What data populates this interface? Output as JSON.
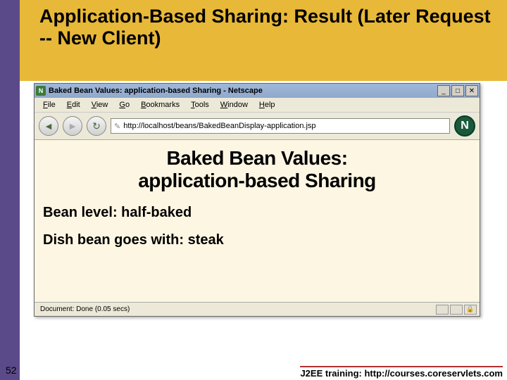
{
  "slide": {
    "title": "Application-Based Sharing: Result (Later Request -- New Client)",
    "number": "52",
    "footer": "J2EE training: http://courses.coreservlets.com"
  },
  "browser": {
    "titlebar": "Baked Bean Values: application-based Sharing - Netscape",
    "minimize": "_",
    "maximize": "□",
    "close": "✕",
    "menus": {
      "file": "File",
      "edit": "Edit",
      "view": "View",
      "go": "Go",
      "bookmarks": "Bookmarks",
      "tools": "Tools",
      "window": "Window",
      "help": "Help"
    },
    "back_glyph": "◄",
    "forward_glyph": "►",
    "reload_glyph": "↻",
    "url_icon": "✎",
    "url": "http://localhost/beans/BakedBeanDisplay-application.jsp",
    "logo_glyph": "N",
    "status": "Document: Done (0.05 secs)",
    "lock_glyph": "🔒"
  },
  "page": {
    "title_line1": "Baked Bean Values:",
    "title_line2": "application-based Sharing",
    "line1_label": "Bean level:",
    "line1_value": " half-baked",
    "line2_label": "Dish bean goes with:",
    "line2_value": " steak"
  }
}
